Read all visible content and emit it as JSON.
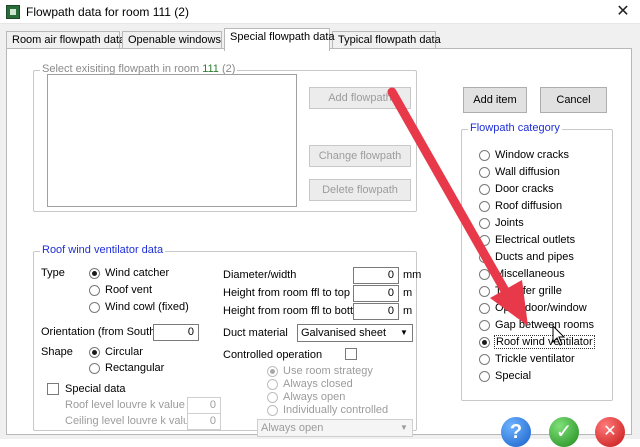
{
  "window": {
    "title": "Flowpath data for room 111 (2)",
    "close_glyph": "✕"
  },
  "tabs": [
    {
      "label": "Room air flowpath data"
    },
    {
      "label": "Openable windows"
    },
    {
      "label": "Special flowpath data"
    },
    {
      "label": "Typical flowpath data"
    }
  ],
  "existing": {
    "legend_prefix": "Select exisiting flowpath in room ",
    "room_number": "111",
    "room_suffix": " (2)",
    "add_label": "Add flowpath",
    "change_label": "Change flowpath",
    "delete_label": "Delete flowpath"
  },
  "actions": {
    "add_item": "Add item",
    "cancel": "Cancel"
  },
  "category": {
    "legend": "Flowpath category",
    "items": [
      "Window cracks",
      "Wall diffusion",
      "Door cracks",
      "Roof diffusion",
      "Joints",
      "Electrical outlets",
      "Ducts and pipes",
      "Miscellaneous",
      "Transfer grille",
      "Open door/window",
      "Gap between rooms",
      "Roof wind ventilator",
      "Trickle ventilator",
      "Special"
    ]
  },
  "rwv": {
    "legend": "Roof wind ventilator data",
    "type_label": "Type",
    "type_options": [
      "Wind catcher",
      "Roof vent",
      "Wind cowl (fixed)"
    ],
    "orientation_label": "Orientation (from South)",
    "orientation_value": "0",
    "shape_label": "Shape",
    "shape_options": [
      "Circular",
      "Rectangular"
    ],
    "special_label": "Special data",
    "roof_k_label": "Roof level louvre k value",
    "roof_k_value": "0",
    "ceiling_k_label": "Ceiling level louvre k value",
    "ceiling_k_value": "0",
    "diameter_label": "Diameter/width",
    "diameter_value": "0",
    "diameter_unit": "mm",
    "top_label": "Height from room ffl to top",
    "top_value": "0",
    "top_unit": "m",
    "bottom_label": "Height from room ffl to bottom",
    "bottom_value": "0",
    "bottom_unit": "m",
    "duct_label": "Duct material",
    "duct_value": "Galvanised sheet",
    "controlled_label": "Controlled operation",
    "control_options": [
      "Use room strategy",
      "Always closed",
      "Always open",
      "Individually controlled"
    ],
    "control_combo_value": "Always open"
  },
  "footer": {
    "help_glyph": "?",
    "ok_glyph": "✓",
    "cancel_glyph": "✕"
  },
  "colors": {
    "legend_blue": "#1f2fd6",
    "room_green": "#2f7d32",
    "annotation_arrow": "#e8394a"
  }
}
